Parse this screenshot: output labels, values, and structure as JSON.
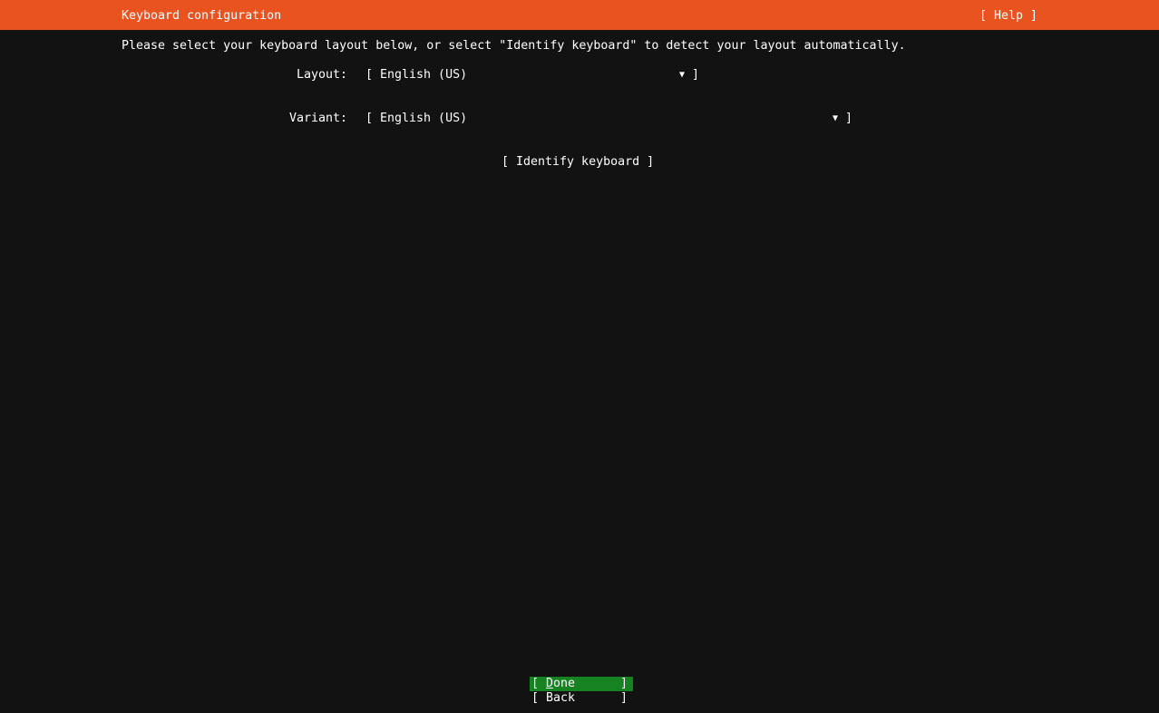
{
  "header": {
    "title": "Keyboard configuration",
    "help_label": "[ Help ]"
  },
  "intro": "Please select your keyboard layout below, or select \"Identify keyboard\" to detect your layout automatically.",
  "form": {
    "layout": {
      "label": "Layout:",
      "open_bracket": "[",
      "value": "English (US)",
      "arrow_icon": "▼",
      "close_bracket": "]"
    },
    "variant": {
      "label": "Variant:",
      "open_bracket": "[",
      "value": "English (US)",
      "arrow_icon": "▼",
      "close_bracket": "]"
    },
    "identify_button_label": "[ Identify keyboard ]"
  },
  "footer": {
    "done": {
      "open_bracket": "[",
      "label": "Done",
      "close_bracket": "]"
    },
    "back": {
      "open_bracket": "[",
      "label": "Back",
      "close_bracket": "]"
    }
  },
  "colors": {
    "header_bg": "#e8531f",
    "focus_bg": "#168222",
    "background": "#121212",
    "text": "#ffffff"
  }
}
